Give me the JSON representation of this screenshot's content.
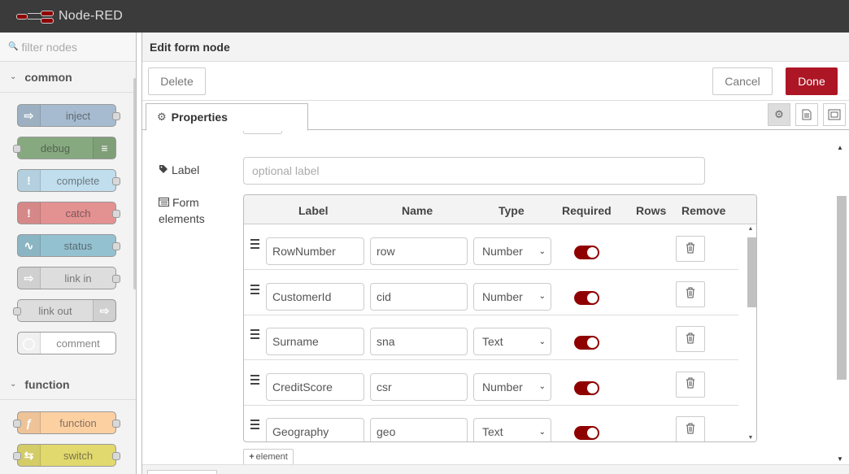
{
  "app": {
    "title": "Node-RED"
  },
  "palette": {
    "filter_placeholder": "filter nodes",
    "categories": [
      {
        "label": "common",
        "nodes": [
          {
            "label": "inject",
            "color": "#a6bbcf",
            "icon": "arrow-in-icon",
            "side": "left",
            "ports": [
              "r"
            ]
          },
          {
            "label": "debug",
            "color": "#87a980",
            "icon": "list-icon",
            "side": "right",
            "ports": [
              "l"
            ]
          },
          {
            "label": "complete",
            "color": "#c0deed",
            "icon": "alert-icon",
            "side": "left",
            "ports": [
              "r"
            ]
          },
          {
            "label": "catch",
            "color": "#e49191",
            "icon": "alert-icon",
            "side": "left",
            "ports": [
              "r"
            ]
          },
          {
            "label": "status",
            "color": "#94c1d0",
            "icon": "pulse-icon",
            "side": "left",
            "ports": [
              "r"
            ]
          },
          {
            "label": "link in",
            "color": "#dddddd",
            "icon": "link-in-icon",
            "side": "left",
            "ports": [
              "r"
            ]
          },
          {
            "label": "link out",
            "color": "#dddddd",
            "icon": "link-out-icon",
            "side": "right",
            "ports": [
              "l"
            ]
          },
          {
            "label": "comment",
            "color": "#ffffff",
            "icon": "comment-icon",
            "side": "left",
            "ports": []
          }
        ]
      },
      {
        "label": "function",
        "nodes": [
          {
            "label": "function",
            "color": "#fdd0a2",
            "icon": "function-icon",
            "side": "left",
            "ports": [
              "l",
              "r"
            ]
          },
          {
            "label": "switch",
            "color": "#e2d96e",
            "icon": "switch-icon",
            "side": "left",
            "ports": [
              "l",
              "r"
            ]
          }
        ]
      }
    ]
  },
  "editor": {
    "title": "Edit form node",
    "delete_label": "Delete",
    "cancel_label": "Cancel",
    "done_label": "Done",
    "tab_label": "Properties",
    "label_field": {
      "label": "Label",
      "placeholder": "optional label"
    },
    "form_elements": {
      "label_line1": "Form",
      "label_line2": "elements",
      "columns": [
        "Label",
        "Name",
        "Type",
        "Required",
        "Rows",
        "Remove"
      ],
      "rows": [
        {
          "label": "RowNumber",
          "name": "row",
          "type": "Number",
          "required": true
        },
        {
          "label": "CustomerId",
          "name": "cid",
          "type": "Number",
          "required": true
        },
        {
          "label": "Surname",
          "name": "sna",
          "type": "Text",
          "required": true
        },
        {
          "label": "CreditScore",
          "name": "csr",
          "type": "Number",
          "required": true
        },
        {
          "label": "Geography",
          "name": "geo",
          "type": "Text",
          "required": true
        }
      ],
      "add_label": "element"
    }
  },
  "colors": {
    "accent": "#ad1625",
    "toggle_on": "#8f0000",
    "header_bg": "#3b3b3b"
  }
}
